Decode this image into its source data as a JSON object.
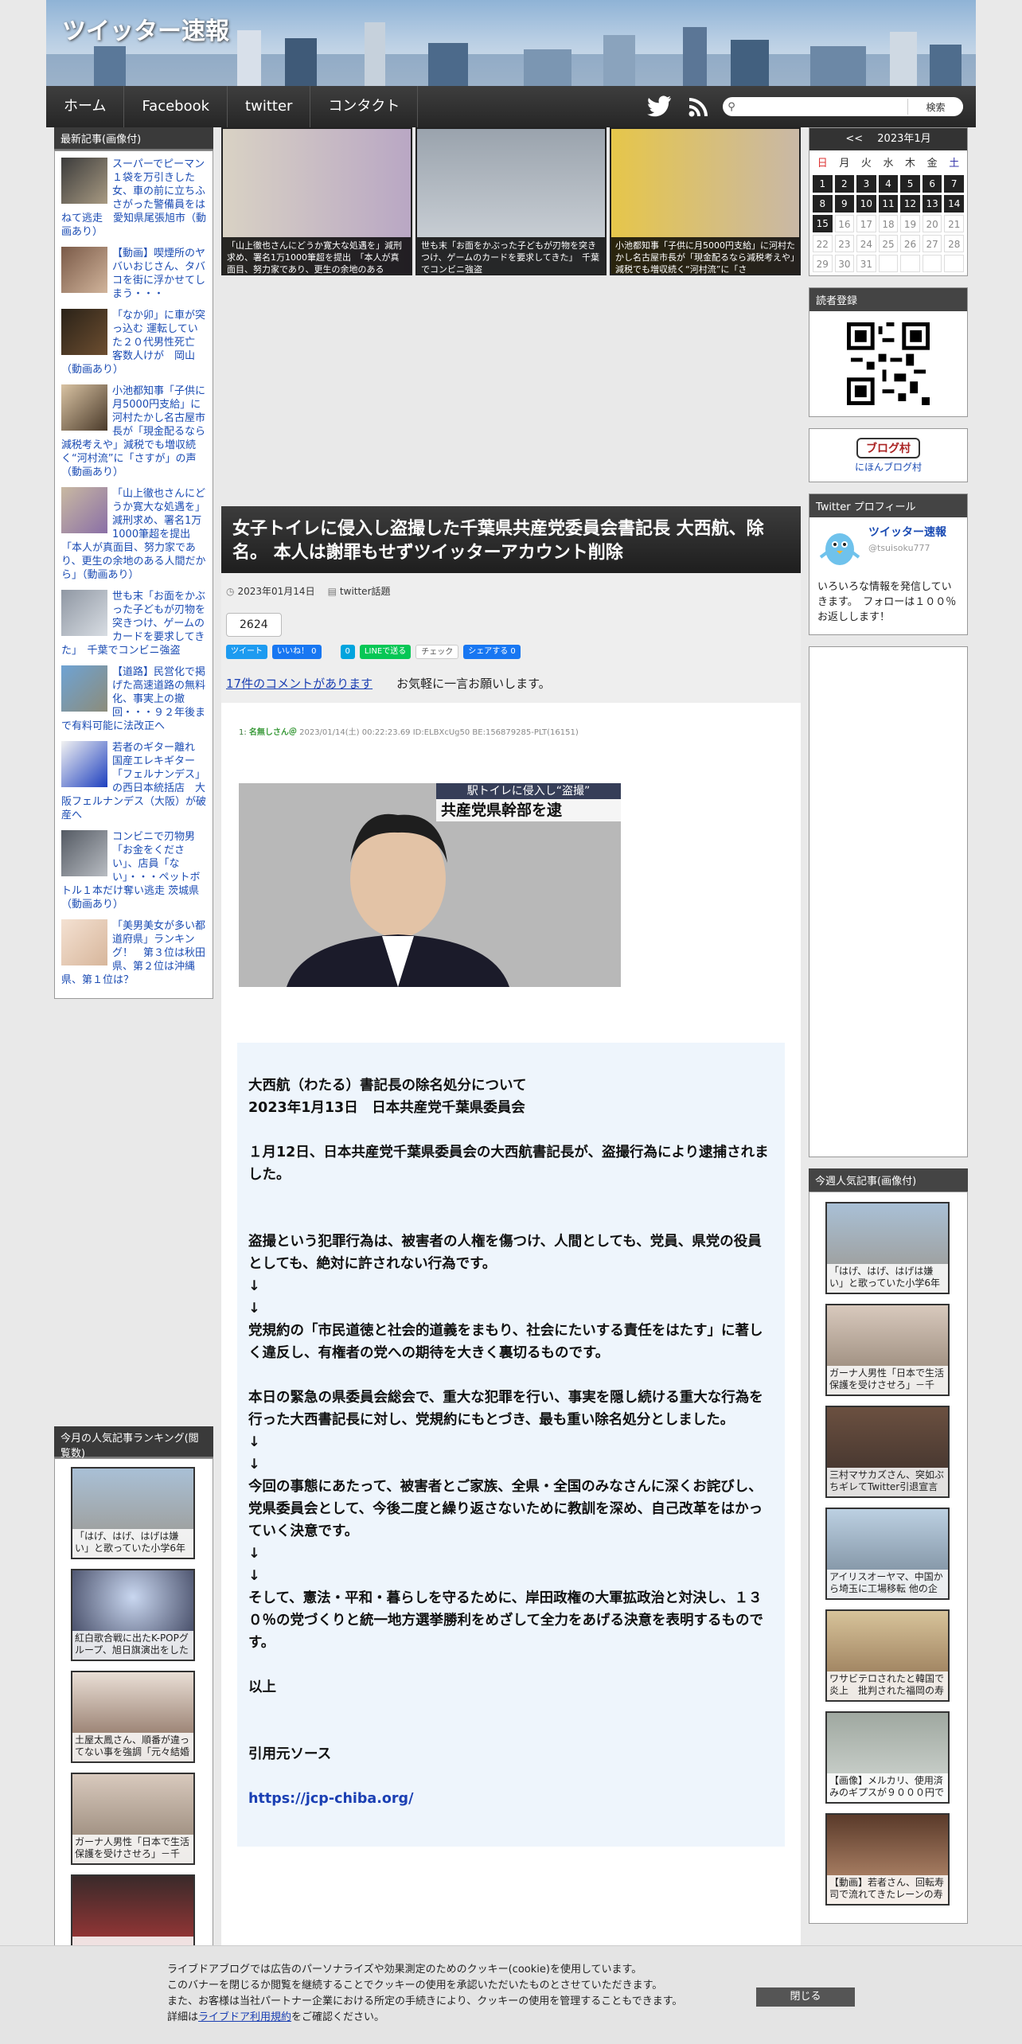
{
  "site": {
    "title": "ツイッター速報"
  },
  "nav": {
    "items": [
      "ホーム",
      "Facebook",
      "twitter",
      "コンタクト"
    ],
    "search_button": "検索"
  },
  "recent": {
    "heading": "最新記事(画像付)",
    "items": [
      "スーパーでピーマン１袋を万引きした女、車の前に立ちふさがった警備員をはねて逃走　愛知県尾張旭市（動画あり）",
      "【動画】喫煙所のヤバいおじさん、タバコを街に浮かせてしまう・・・",
      "「なか卯」に車が突っ込む 運転していた２０代男性死亡 客数人けが　岡山（動画あり）",
      "小池都知事「子供に月5000円支給」に河村たかし名古屋市長が「現金配るなら減税考えや」減税でも増収続く“河村流”に「さすが」の声（動画あり）",
      "「山上徹也さんにどうか寛大な処遇を」減刑求め、署名1万1000筆超を提出　「本人が真面目、努力家であり、更生の余地のある人間だから」（動画あり）",
      "世も末「お面をかぶった子どもが刃物を突きつけ、ゲームのカードを要求してきた」　千葉でコンビニ強盗",
      "【道路】民営化で掲げた高速道路の無料化、事実上の撤回・・・９２年後まで有料可能に法改正へ",
      "若者のギター離れ　国産エレキギター「フェルナンデス」の西日本統括店　大阪フェルナンデス（大阪）が破産へ",
      "コンビニで刃物男「お金をください」、店員「ない」・・・ペットボトル１本だけ奪い逃走 茨城県（動画あり）",
      "「美男美女が多い都道府県」ランキング！　第３位は秋田県、第２位は沖縄県、第１位は？"
    ]
  },
  "ranking": {
    "heading": "今月の人気記事ランキング(閲覧数)",
    "items": [
      "「はげ、はげ、はげは嫌い」と歌っていた小学6年",
      "紅白歌合戦に出たK-POPグループ、旭日旗演出をした",
      "土屋太鳳さん、順番が違ってない事を強調「元々結婚",
      "ガーナ人男性「日本で生活保護を受けさせろ」－千",
      ""
    ]
  },
  "carousel": [
    "「山上徹也さんにどうか寛大な処遇を」減刑求め、署名1万1000筆超を提出　「本人が真面目、努力家であり、更生の余地のある",
    "世も末「お面をかぶった子どもが刃物を突きつけ、ゲームのカードを要求してきた」　千葉でコンビニ強盗",
    "小池都知事「子供に月5000円支給」に河村たかし名古屋市長が「現金配るなら減税考えや」減税でも増収続く“河村流”に「さ"
  ],
  "article": {
    "title": "女子トイレに侵入し盗撮した千葉県共産党委員会書記長 大西航、除名。 本人は謝罪もせずツイッターアカウント削除",
    "date": "2023年01月14日",
    "category": "twitter話題",
    "count": "2624",
    "share": {
      "tweet": "ツイート",
      "like": "いいね！ 0",
      "hatena": "0",
      "line": "LINEで送る",
      "check": "チェック",
      "fb": "シェアする 0"
    },
    "comments_link": "17件のコメントがあります",
    "comment_prompt": "お気軽に一言お願いします。",
    "post": {
      "num": "1:",
      "name": "名無しさん＠",
      "info": "2023/01/14(土) 00:22:23.69 ID:ELBXcUg50 BE:156879285-PLT(16151)"
    },
    "image_caption_top": "駅トイレに侵入し“盗撮”",
    "image_caption_main": "共産党県幹部を逮",
    "statement": {
      "title": "大西航（わたる）書記長の除名処分について",
      "date_line": "2023年1月13日　日本共産党千葉県委員会",
      "p1": "１月12日、日本共産党千葉県委員会の大西航書記長が、盗撮行為により逮捕されました。",
      "p2": "盗撮という犯罪行為は、被害者の人権を傷つけ、人間としても、党員、県党の役員としても、絶対に許されない行為です。",
      "arrow": "↓",
      "p3": "党規約の「市民道徳と社会的道義をまもり、社会にたいする責任をはたす」に著しく違反し、有権者の党への期待を大きく裏切るものです。",
      "p4": "本日の緊急の県委員会総会で、重大な犯罪を行い、事実を隠し続ける重大な行為を行った大西書記長に対し、党規約にもとづき、最も重い除名処分としました。",
      "p5": "今回の事態にあたって、被害者とご家族、全県・全国のみなさんに深くお詫びし、党県委員会として、今後二度と繰り返さないために教訓を深め、自己改革をはかっていく決意です。",
      "p6": "そして、憲法・平和・暮らしを守るために、岸田政権の大軍拡政治と対決し、１３０％の党づくりと統一地方選挙勝利をめざして全力をあげる決意を表明するものです。",
      "end": "以上",
      "source_label": "引用元ソース",
      "source_url": "https://jcp-chiba.org/"
    }
  },
  "calendar": {
    "prev": "<<",
    "month": "2023年1月",
    "dow": [
      "日",
      "月",
      "火",
      "水",
      "木",
      "金",
      "土"
    ],
    "past_days": [
      "1",
      "2",
      "3",
      "4",
      "5",
      "6",
      "7",
      "8",
      "9",
      "10",
      "11",
      "12",
      "13",
      "14",
      "15"
    ],
    "future_days": [
      "16",
      "17",
      "18",
      "19",
      "20",
      "21",
      "22",
      "23",
      "24",
      "25",
      "26",
      "27",
      "28",
      "29",
      "30",
      "31"
    ]
  },
  "reader": {
    "heading": "読者登録"
  },
  "blogmura": {
    "logo": "ブログ村",
    "label": "にほんブログ村"
  },
  "twitter_profile": {
    "heading": "Twitter プロフィール",
    "name": "ツイッター速報",
    "handle": "@tsuisoku777",
    "desc": "いろいろな情報を発信していきます。　フォローは１００％お返しします！"
  },
  "weekly": {
    "heading": "今週人気記事(画像付)",
    "items": [
      "「はげ、はげ、はげは嫌い」と歌っていた小学6年",
      "ガーナ人男性「日本で生活保護を受けさせろ」－千",
      "三村マサカズさん、突如ぶちギレてTwitter引退宣言",
      "アイリスオーヤマ、中国から埼玉に工場移転 他の企",
      "ワサビテロされたと韓国で炎上　批判された福岡の寿",
      "【画像】メルカリ、使用済みのギプスが９０００円で",
      "【動画】若者さん、回転寿司で流れてきたレーンの寿"
    ]
  },
  "cookie": {
    "line1": "ライブドアブログでは広告のパーソナライズや効果測定のためのクッキー(cookie)を使用しています。",
    "line2": "このバナーを閉じるか閲覧を継続することでクッキーの使用を承認いただいたものとさせていただきます。",
    "line3": "また、お客様は当社パートナー企業における所定の手続きにより、クッキーの使用を管理することもできます。",
    "line4_pre": "詳細は",
    "line4_link": "ライブドア利用規約",
    "line4_post": "をご確認ください。",
    "close": "閉じる"
  }
}
